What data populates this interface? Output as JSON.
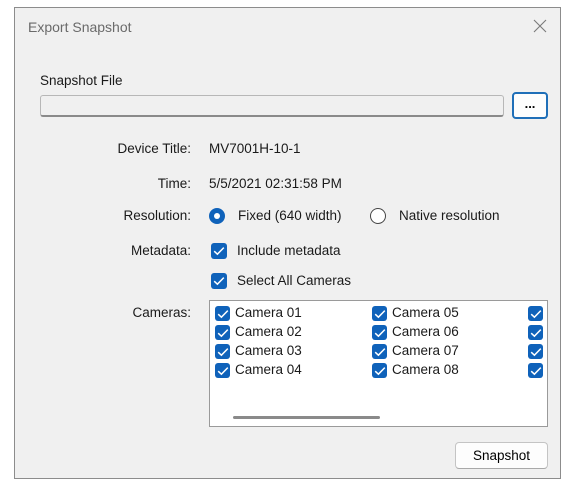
{
  "window": {
    "title": "Export Snapshot"
  },
  "snapshot_file": {
    "label": "Snapshot File",
    "value": "",
    "browse_label": "..."
  },
  "device_title": {
    "label": "Device Title:",
    "value": "MV7001H-10-1"
  },
  "time": {
    "label": "Time:",
    "value": "5/5/2021 02:31:58 PM"
  },
  "resolution": {
    "label": "Resolution:",
    "options": [
      {
        "label": "Fixed (640 width)",
        "selected": true
      },
      {
        "label": "Native resolution",
        "selected": false
      }
    ]
  },
  "metadata": {
    "label": "Metadata:",
    "include_label": "Include metadata",
    "include_checked": true,
    "select_all_label": "Select All Cameras",
    "select_all_checked": true
  },
  "cameras": {
    "label": "Cameras:",
    "items": [
      {
        "label": "Camera 01",
        "checked": true
      },
      {
        "label": "Camera 02",
        "checked": true
      },
      {
        "label": "Camera 03",
        "checked": true
      },
      {
        "label": "Camera 04",
        "checked": true
      },
      {
        "label": "Camera 05",
        "checked": true
      },
      {
        "label": "Camera 06",
        "checked": true
      },
      {
        "label": "Camera 07",
        "checked": true
      },
      {
        "label": "Camera 08",
        "checked": true
      }
    ]
  },
  "buttons": {
    "snapshot_label": "Snapshot"
  },
  "colors": {
    "accent": "#0f62ba",
    "dialog_bg": "#f0f0f0",
    "focus_border": "#1f6fb8"
  }
}
